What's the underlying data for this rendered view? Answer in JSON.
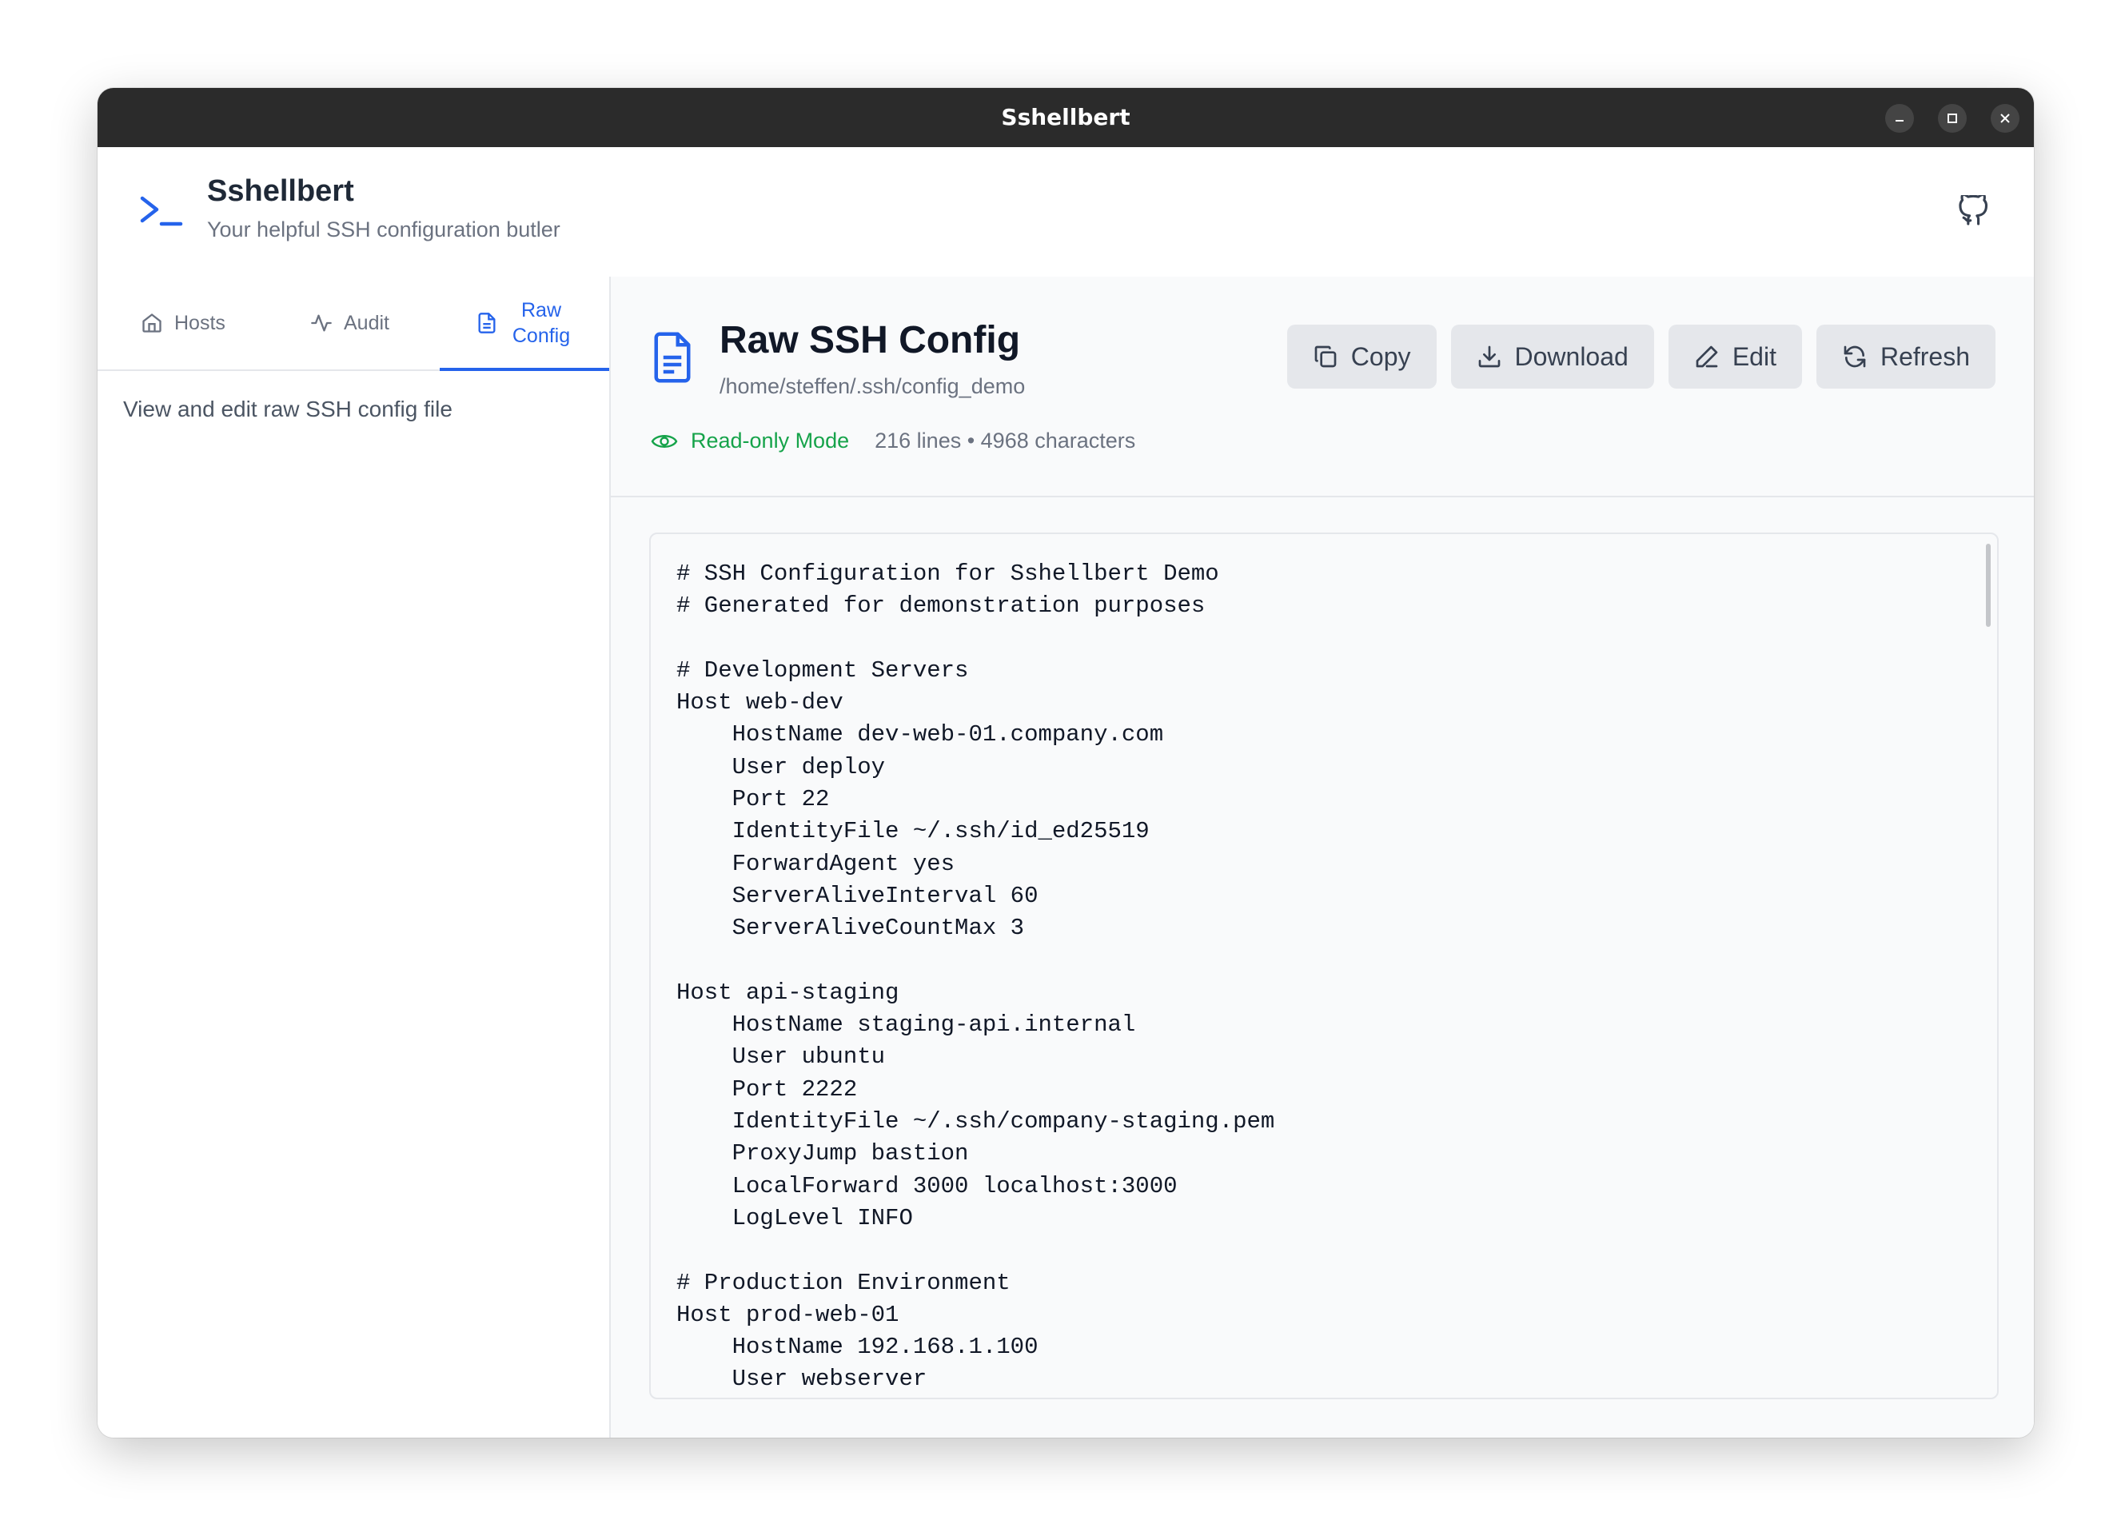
{
  "window": {
    "title": "Sshellbert"
  },
  "app": {
    "name": "Sshellbert",
    "tagline": "Your helpful SSH configuration butler"
  },
  "tabs": [
    {
      "label": "Hosts",
      "active": false
    },
    {
      "label": "Audit",
      "active": false
    },
    {
      "label": "Raw Config",
      "active": true
    }
  ],
  "sidebar": {
    "description": "View and edit raw SSH config file"
  },
  "main": {
    "title": "Raw SSH Config",
    "path": "/home/steffen/.ssh/config_demo",
    "mode": "Read-only Mode",
    "stats": "216 lines • 4968 characters",
    "buttons": {
      "copy": "Copy",
      "download": "Download",
      "edit": "Edit",
      "refresh": "Refresh"
    }
  },
  "config_text": "# SSH Configuration for Sshellbert Demo\n# Generated for demonstration purposes\n\n# Development Servers\nHost web-dev\n    HostName dev-web-01.company.com\n    User deploy\n    Port 22\n    IdentityFile ~/.ssh/id_ed25519\n    ForwardAgent yes\n    ServerAliveInterval 60\n    ServerAliveCountMax 3\n\nHost api-staging\n    HostName staging-api.internal\n    User ubuntu\n    Port 2222\n    IdentityFile ~/.ssh/company-staging.pem\n    ProxyJump bastion\n    LocalForward 3000 localhost:3000\n    LogLevel INFO\n\n# Production Environment\nHost prod-web-01\n    HostName 192.168.1.100\n    User webserver",
  "colors": {
    "accent": "#2563eb",
    "success": "#16a34a",
    "titlebar": "#2b2b2b"
  },
  "icons": {
    "logo": "terminal-prompt-icon",
    "github": "github-icon",
    "hosts": "home-icon",
    "audit": "activity-icon",
    "raw": "file-text-icon",
    "mode": "eye-icon"
  }
}
